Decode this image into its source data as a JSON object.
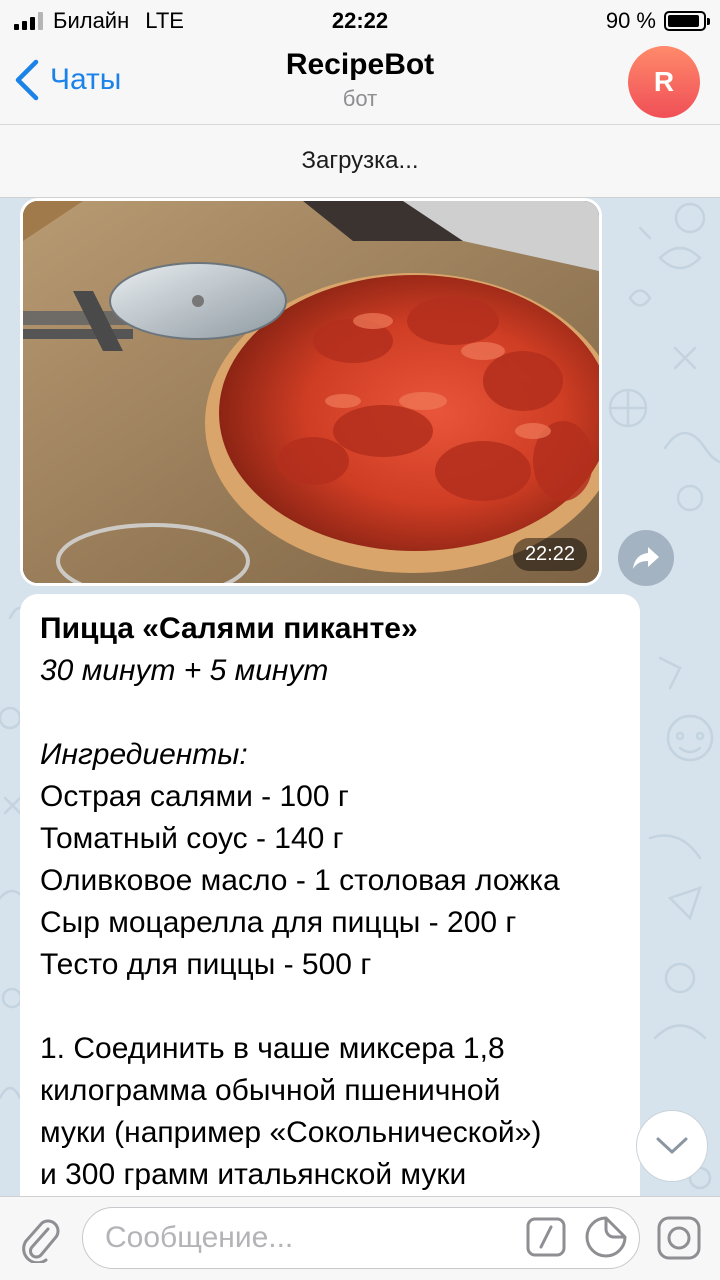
{
  "status_bar": {
    "carrier": "Билайн",
    "network": "LTE",
    "time": "22:22",
    "battery": "90 %",
    "battery_level": 0.9
  },
  "nav": {
    "back_label": "Чаты",
    "title": "RecipeBot",
    "subtitle": "бот",
    "avatar_letter": "R"
  },
  "loading_text": "Загрузка...",
  "photo_message": {
    "time": "22:22"
  },
  "text_message": {
    "title": "Пицца «Салями пиканте»",
    "duration": "30 минут + 5 минут",
    "ingredients_heading": "Ингредиенты:",
    "ingredients": [
      "Острая салями - 100 г",
      "Томатный соус - 140 г",
      "Оливковое масло - 1 столовая ложка",
      "Сыр моцарелла для пиццы - 200 г",
      "Тесто для пиццы - 500 г"
    ],
    "step_lines": [
      "1. Соединить в чаше миксера 1,8",
      "килограмма обычной пшеничной",
      "муки (например «Сокольнической»)",
      "и 300 грамм итальянской муки"
    ]
  },
  "input": {
    "placeholder": "Сообщение..."
  },
  "colors": {
    "accent": "#1a82e8",
    "chat_background": "#d7e3ec",
    "avatar_gradient": [
      "#ff8a6b",
      "#f04f57"
    ]
  },
  "icons": {
    "back": "chevron-left-icon",
    "share": "share-arrow-icon",
    "scroll_down": "chevron-down-icon",
    "attach": "paperclip-icon",
    "commands": "slash-command-icon",
    "sticker": "sticker-icon",
    "camera": "camera-icon"
  }
}
